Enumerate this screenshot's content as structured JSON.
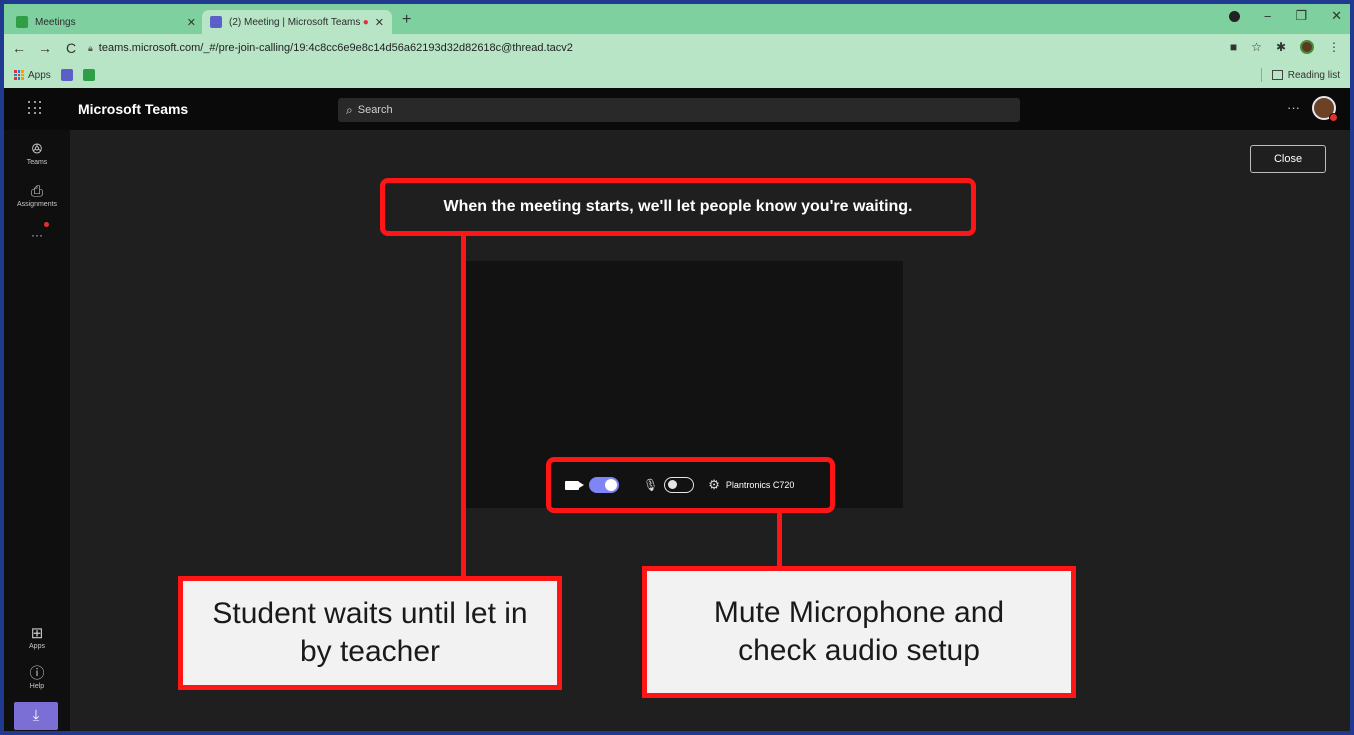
{
  "browser": {
    "tabs": [
      {
        "title": "Meetings",
        "active": false
      },
      {
        "title": "(2) Meeting | Microsoft Teams",
        "active": true,
        "recording": true
      }
    ],
    "new_tab": "+",
    "url": "teams.microsoft.com/_#/pre-join-calling/19:4c8cc6e9e8c14d56a62193d32d82618c@thread.tacv2",
    "bookmarks": {
      "apps_label": "Apps"
    },
    "reading_list": "Reading list"
  },
  "teams": {
    "app_title": "Microsoft Teams",
    "search_placeholder": "Search",
    "more": "···",
    "rail": {
      "teams": "Teams",
      "assignments": "Assignments",
      "more": "···",
      "apps": "Apps",
      "help": "Help"
    }
  },
  "prejoin": {
    "close_label": "Close",
    "waiting_message": "When the meeting starts, we'll let people know you're waiting.",
    "camera_on": true,
    "mic_on": false,
    "device_name": "Plantronics C720"
  },
  "callouts": {
    "left": "Student waits until let in by teacher",
    "right": "Mute Microphone and check audio setup"
  },
  "colors": {
    "highlight_red": "#ff1515",
    "toggle_accent": "#7f85f5",
    "chrome_green": "#b7e5c6",
    "border_blue": "#1f3a8f"
  }
}
